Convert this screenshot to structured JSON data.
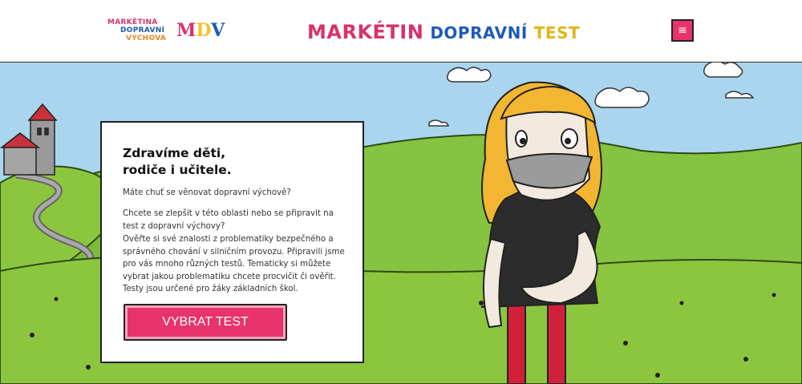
{
  "header": {
    "logo": {
      "line1": "MARKÉTINA",
      "line2": "DOPRAVNÍ",
      "line3": "VÝCHOVA",
      "mdv": [
        "M",
        "D",
        "V"
      ]
    },
    "title": {
      "word1": "MARKÉTIN",
      "word2": "DOPRAVNÍ",
      "word3": "TEST"
    },
    "menu_icon": "≡",
    "icons": {
      "menu": "hamburger-icon"
    }
  },
  "hero": {
    "heading_line1": "Zdravíme děti,",
    "heading_line2": "rodiče i učitele.",
    "paragraph1": "Máte chuť se věnovat dopravní výchově?",
    "paragraph2": "Chcete se zlepšit v této oblasti nebo se připravit na test z dopravní výchovy?",
    "paragraph3": "Ověřte si své znalosti z problematiky bezpečného a správného chování v silničním provozu. Připravili jsme pro vás mnoho různých testů. Tematicky si můžete vybrat jakou problematiku chcete procvičit či ověřit. Testy jsou určené pro žáky základních škol.",
    "cta_label": "VYBRAT TEST"
  },
  "colors": {
    "accent_pink": "#e8336c",
    "brand_blue": "#1f5bb5",
    "brand_yellow": "#e0b51a",
    "sky": "#a9d6ee",
    "grass": "#8cc63f"
  }
}
